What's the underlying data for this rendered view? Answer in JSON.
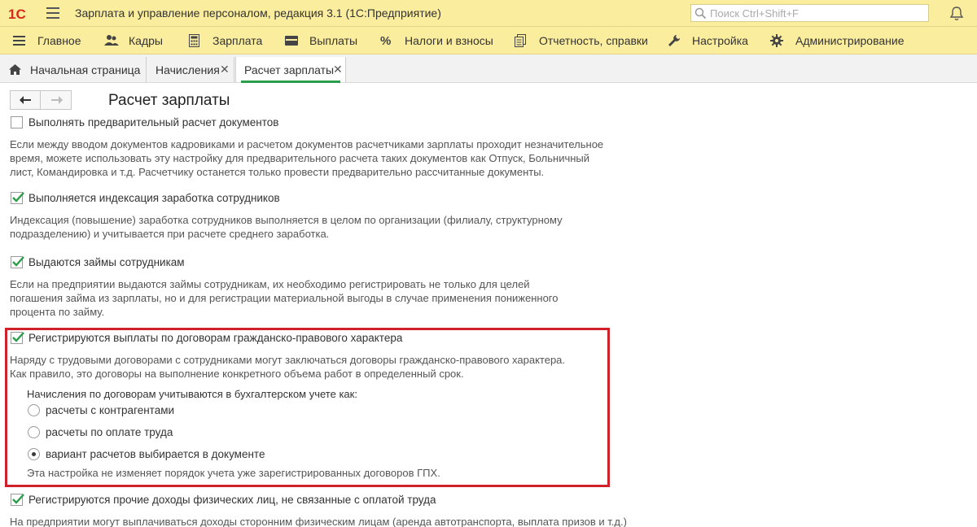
{
  "app": {
    "logo": "1С",
    "title": "Зарплата и управление персоналом, редакция 3.1  (1С:Предприятие)",
    "search_placeholder": "Поиск Ctrl+Shift+F"
  },
  "menu": [
    {
      "label": "Главное",
      "icon": "menu-icon"
    },
    {
      "label": "Кадры",
      "icon": "people-icon"
    },
    {
      "label": "Зарплата",
      "icon": "calculator-icon"
    },
    {
      "label": "Выплаты",
      "icon": "wallet-icon"
    },
    {
      "label": "Налоги и взносы",
      "icon": "percent-icon"
    },
    {
      "label": "Отчетность, справки",
      "icon": "reports-icon"
    },
    {
      "label": "Настройка",
      "icon": "wrench-icon"
    },
    {
      "label": "Администрирование",
      "icon": "gear-icon"
    }
  ],
  "tabs": [
    {
      "label": "Начальная страница"
    },
    {
      "label": "Начисления"
    },
    {
      "label": "Расчет зарплаты"
    }
  ],
  "page": {
    "title": "Расчет зарплаты"
  },
  "settings": [
    {
      "label": "Выполнять предварительный расчет документов",
      "checked": false,
      "desc": [
        "Если между вводом документов кадровиками и расчетом документов расчетчиками зарплаты проходит незначительное",
        "время, можете использовать эту настройку для предварительного расчета таких документов как Отпуск, Больничный",
        "лист, Командировка и т.д. Расчетчику останется только провести предварительно рассчитанные документы."
      ]
    },
    {
      "label": "Выполняется индексация заработка сотрудников",
      "checked": true,
      "desc": [
        "Индексация (повышение) заработка сотрудников выполняется в целом по организации (филиалу, структурному",
        "подразделению) и учитывается при расчете среднего заработка."
      ]
    },
    {
      "label": "Выдаются займы сотрудникам",
      "checked": true,
      "desc": [
        "Если на предприятии выдаются займы сотрудникам, их необходимо регистрировать не только для целей",
        "погашения займа из зарплаты, но и для регистрации материальной выгоды в случае применения пониженного",
        "процента по займу."
      ]
    },
    {
      "label": "Регистрируются выплаты по договорам гражданско-правового характера",
      "checked": true,
      "desc": [
        "Наряду с трудовыми договорами с сотрудниками могут заключаться договоры гражданско-правового характера.",
        "Как правило, это договоры на выполнение конкретного объема работ в определенный срок."
      ]
    },
    {
      "label": "Регистрируются прочие доходы физических лиц, не связанные с оплатой труда",
      "checked": true,
      "desc": [
        "На предприятии могут выплачиваться доходы сторонним физическим лицам (аренда автотранспорта, выплата призов и т.д.)"
      ]
    }
  ],
  "gph": {
    "accounting_label": "Начисления по договорам учитываются в бухгалтерском учете как:",
    "options": [
      {
        "label": "расчеты с контрагентами",
        "selected": false
      },
      {
        "label": "расчеты по оплате труда",
        "selected": false
      },
      {
        "label": "вариант расчетов выбирается в документе",
        "selected": true
      }
    ],
    "note": "Эта настройка не изменяет порядок учета уже зарегистрированных договоров ГПХ."
  },
  "colors": {
    "accent": "#2a9d4a",
    "highlight": "#d0202a",
    "bar": "#fbed9e"
  }
}
